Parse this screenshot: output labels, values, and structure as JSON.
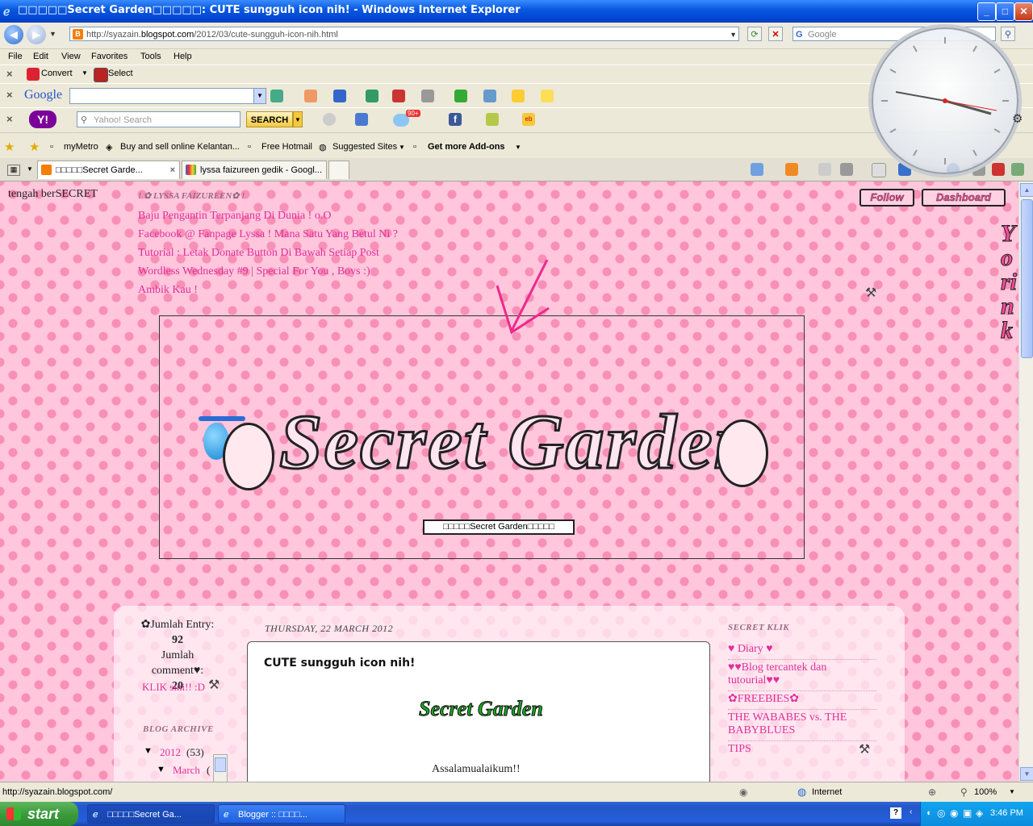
{
  "window": {
    "title": "□□□□□Secret Garden□□□□□: CUTE sungguh icon nih! - Windows Internet Explorer",
    "minimize": "_",
    "maximize": "□",
    "close": "✕"
  },
  "address": {
    "url_prefix": "http://syazain.",
    "url_host": "blogspot.com",
    "url_path": "/2012/03/cute-sungguh-icon-nih.html",
    "search_placeholder": "Google"
  },
  "menu": [
    "File",
    "Edit",
    "View",
    "Favorites",
    "Tools",
    "Help"
  ],
  "convert_toolbar": {
    "convert": "Convert",
    "select": "Select"
  },
  "google_toolbar": {
    "logo": "Google"
  },
  "yahoo_toolbar": {
    "logo": "Y!",
    "search_placeholder": "Yahoo! Search",
    "search_button": "SEARCH",
    "mail_count": "90+"
  },
  "favorites": {
    "items": [
      "myMetro",
      "Buy and sell online Kelantan...",
      "Free Hotmail",
      "Suggested Sites",
      "Get more Add-ons"
    ]
  },
  "tabs": [
    {
      "label": "□□□□□Secret Garde..."
    },
    {
      "label": "lyssa faizureen gedik - Googl..."
    }
  ],
  "blog": {
    "topleft": "tengah berSECRET",
    "widget_title": "! ✿ LYSSA FAIZUREEN✿ !",
    "recent_links": [
      "Baju Pengantin Terpanjang Di Dunia ! o.O",
      "Facebook @ Fanpage Lyssa ! Mana Satu Yang Betul Ni ?",
      "Tutorial : Letak Donate Button Di Bawah Setiap Post",
      "Wordless Wednesday #9 | Special For You , Boys :)",
      "Ambik Kau !"
    ],
    "follow": "Follow",
    "dashboard": "Dashboard",
    "side_text": "Yorink",
    "header_title": "Secret Garden",
    "header_caption": "□□□□□Secret Garden□□□□□",
    "stats": {
      "entry_label": "✿Jumlah Entry:",
      "entry_count": "92",
      "comment_label": "Jumlah comment♥:",
      "comment_count": "20",
      "klik": "KLIK sini!! :D"
    },
    "archive": {
      "title": "BLOG ARCHIVE",
      "year": "2012",
      "year_count": "(53)",
      "month": "March",
      "month_count": "("
    },
    "post": {
      "date": "THURSDAY, 22 MARCH 2012",
      "title": "CUTE sungguh icon nih!",
      "banner": "Secret Garden",
      "greeting": "Assalamualaikum!!"
    },
    "secretklik": {
      "title": "SECRET KLIK",
      "links": [
        "♥ Diary ♥",
        "♥♥Blog tercantek dan tutourial♥♥",
        "✿FREEBIES✿",
        "THE WABABES vs. THE BABYBLUES",
        "TIPS"
      ]
    }
  },
  "status": {
    "url": "http://syazain.blogspot.com/",
    "zone": "Internet",
    "zoom": "100%"
  },
  "taskbar": {
    "start": "start",
    "tasks": [
      "□□□□□Secret Ga...",
      "Blogger :: □□□□..."
    ],
    "time": "3:46 PM"
  }
}
